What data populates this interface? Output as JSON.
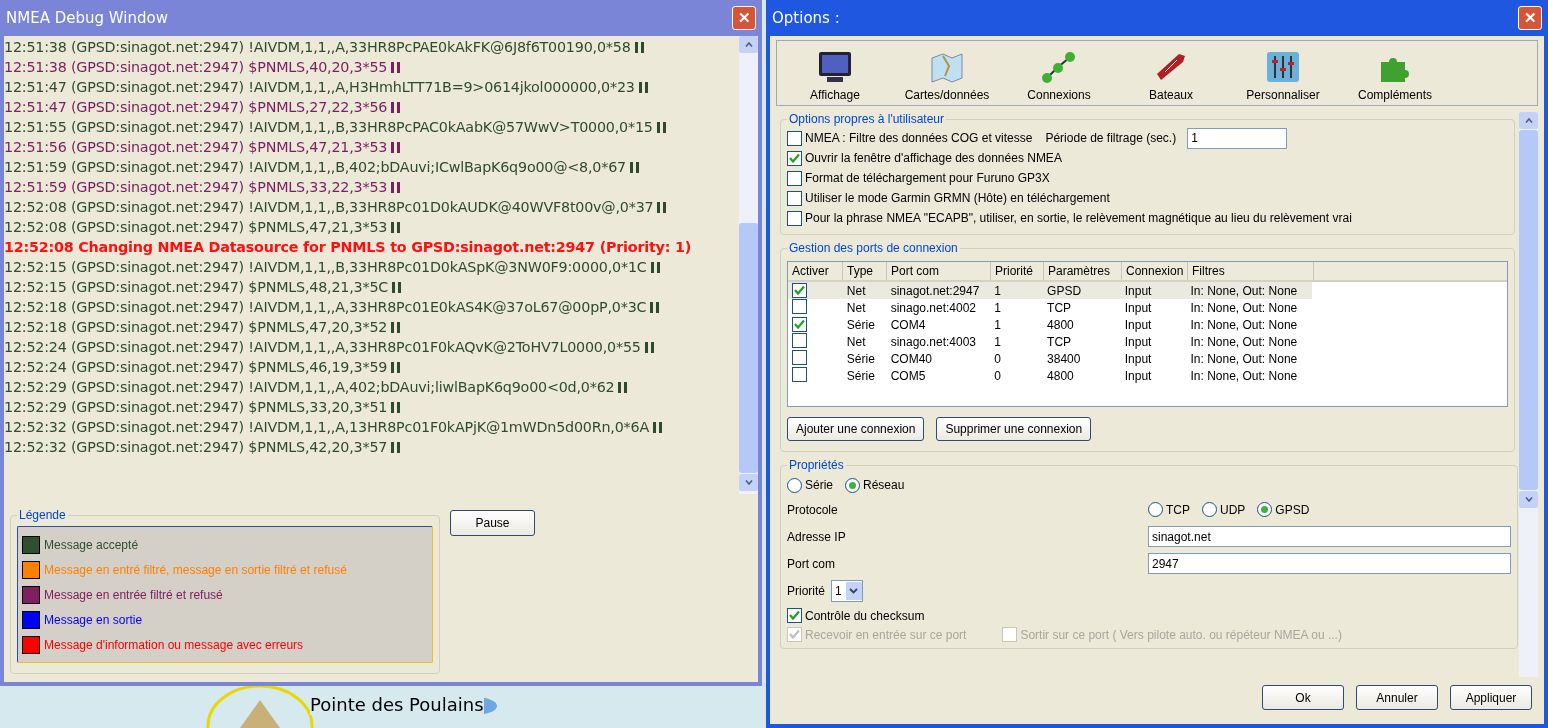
{
  "debug_window": {
    "title": "NMEA Debug Window",
    "close": "✕",
    "lines": [
      {
        "kind": "accepted",
        "text": "12:51:38 (GPSD:sinagot.net:2947) !AIVDM,1,1,,A,33HR8PcPAE0kAkFK@6J8f6T00190,0*58",
        "eol": true
      },
      {
        "kind": "filtered",
        "text": "12:51:38 (GPSD:sinagot.net:2947) $PNMLS,40,20,3*55",
        "eol": true
      },
      {
        "kind": "accepted",
        "text": "12:51:47 (GPSD:sinagot.net:2947) !AIVDM,1,1,,A,H3HmhLTT71B=9>0614jkol000000,0*23",
        "eol": true
      },
      {
        "kind": "filtered",
        "text": "12:51:47 (GPSD:sinagot.net:2947) $PNMLS,27,22,3*56",
        "eol": true
      },
      {
        "kind": "accepted",
        "text": "12:51:55 (GPSD:sinagot.net:2947) !AIVDM,1,1,,B,33HR8PcPAC0kAabK@57WwV>T0000,0*15",
        "eol": true
      },
      {
        "kind": "filtered",
        "text": "12:51:56 (GPSD:sinagot.net:2947) $PNMLS,47,21,3*53",
        "eol": true
      },
      {
        "kind": "accepted",
        "text": "12:51:59 (GPSD:sinagot.net:2947) !AIVDM,1,1,,B,402;bDAuvi;ICwlBapK6q9o00@<8,0*67",
        "eol": true
      },
      {
        "kind": "filtered",
        "text": "12:51:59 (GPSD:sinagot.net:2947) $PNMLS,33,22,3*53",
        "eol": true
      },
      {
        "kind": "accepted",
        "text": "12:52:08 (GPSD:sinagot.net:2947) !AIVDM,1,1,,B,33HR8Pc01D0kAUDK@40WVF8t00v@,0*37",
        "eol": true
      },
      {
        "kind": "accepted",
        "text": "12:52:08 (GPSD:sinagot.net:2947) $PNMLS,47,21,3*53",
        "eol": true
      },
      {
        "kind": "info",
        "text": "12:52:08 Changing NMEA Datasource for PNMLS to GPSD:sinagot.net:2947 (Priority: 1)",
        "eol": false
      },
      {
        "kind": "accepted",
        "text": "12:52:15 (GPSD:sinagot.net:2947) !AIVDM,1,1,,B,33HR8Pc01D0kASpK@3NW0F9:0000,0*1C",
        "eol": true
      },
      {
        "kind": "accepted",
        "text": "12:52:15 (GPSD:sinagot.net:2947) $PNMLS,48,21,3*5C",
        "eol": true
      },
      {
        "kind": "accepted",
        "text": "12:52:18 (GPSD:sinagot.net:2947) !AIVDM,1,1,,A,33HR8Pc01E0kAS4K@37oL67@00pP,0*3C",
        "eol": true
      },
      {
        "kind": "accepted",
        "text": "12:52:18 (GPSD:sinagot.net:2947) $PNMLS,47,20,3*52",
        "eol": true
      },
      {
        "kind": "accepted",
        "text": "12:52:24 (GPSD:sinagot.net:2947) !AIVDM,1,1,,A,33HR8Pc01F0kAQvK@2ToHV7L0000,0*55",
        "eol": true
      },
      {
        "kind": "accepted",
        "text": "12:52:24 (GPSD:sinagot.net:2947) $PNMLS,46,19,3*59",
        "eol": true
      },
      {
        "kind": "accepted",
        "text": "12:52:29 (GPSD:sinagot.net:2947) !AIVDM,1,1,,A,402;bDAuvi;liwlBapK6q9o00<0d,0*62",
        "eol": true
      },
      {
        "kind": "accepted",
        "text": "12:52:29 (GPSD:sinagot.net:2947) $PNMLS,33,20,3*51",
        "eol": true
      },
      {
        "kind": "accepted",
        "text": "12:52:32 (GPSD:sinagot.net:2947) !AIVDM,1,1,,A,13HR8Pc01F0kAPjK@1mWDn5d00Rn,0*6A",
        "eol": true
      },
      {
        "kind": "accepted",
        "text": "12:52:32 (GPSD:sinagot.net:2947) $PNMLS,42,20,3*57",
        "eol": true
      }
    ],
    "legend": {
      "title": "Légende",
      "items": [
        {
          "color": "#2f4f2f",
          "label": "Message accepté"
        },
        {
          "color": "#ff8000",
          "label": "Message en entré filtré, message en sortie filtré et refusé"
        },
        {
          "color": "#802060",
          "label": "Message en entrée filtré et refusé"
        },
        {
          "color": "#0000ff",
          "label": "Message en sortie"
        },
        {
          "color": "#ff0000",
          "label": "Message d'information ou message avec erreurs"
        }
      ]
    },
    "pause_button": "Pause"
  },
  "map": {
    "label": "Pointe des Poulains"
  },
  "options_window": {
    "title": "Options :",
    "close": "✕",
    "toolbar": [
      "Affichage",
      "Cartes/données",
      "Connexions",
      "Bateaux",
      "Personnaliser",
      "Compléments"
    ],
    "user_options": {
      "title": "Options propres à l'utilisateur",
      "items": [
        {
          "label": "NMEA : Filtre des données COG et vitesse",
          "checked": false,
          "period_label": "Période de filtrage (sec.)",
          "period_value": "1"
        },
        {
          "label": "Ouvrir la fenêtre d'affichage des données NMEA",
          "checked": true
        },
        {
          "label": "Format de téléchargement pour Furuno GP3X",
          "checked": false
        },
        {
          "label": "Utiliser le mode Garmin GRMN (Hôte) en téléchargement",
          "checked": false
        },
        {
          "label": "Pour la phrase NMEA \"ECAPB\", utiliser, en sortie, le relèvement magnétique  au lieu du relèvement vrai",
          "checked": false
        }
      ]
    },
    "ports": {
      "title": "Gestion des ports de connexion",
      "columns": [
        "Activer",
        "Type",
        "Port com",
        "Priorité",
        "Paramètres",
        "Connexion",
        "Filtres"
      ],
      "rows": [
        {
          "active": true,
          "selected": true,
          "type": "Net",
          "port_com": "sinagot.net:2947",
          "priority": "1",
          "parameters": "GPSD",
          "connection": "Input",
          "filters": "In: None, Out: None"
        },
        {
          "active": false,
          "selected": false,
          "type": "Net",
          "port_com": "sinago.net:4002",
          "priority": "1",
          "parameters": "TCP",
          "connection": "Input",
          "filters": "In: None, Out: None"
        },
        {
          "active": true,
          "selected": false,
          "type": "Série",
          "port_com": "COM4",
          "priority": "1",
          "parameters": "4800",
          "connection": "Input",
          "filters": "In: None, Out: None"
        },
        {
          "active": false,
          "selected": false,
          "type": "Net",
          "port_com": "sinago.net:4003",
          "priority": "1",
          "parameters": "TCP",
          "connection": "Input",
          "filters": "In: None, Out: None"
        },
        {
          "active": false,
          "selected": false,
          "type": "Série",
          "port_com": "COM40",
          "priority": "0",
          "parameters": "38400",
          "connection": "Input",
          "filters": "In: None, Out: None"
        },
        {
          "active": false,
          "selected": false,
          "type": "Série",
          "port_com": "COM5",
          "priority": "0",
          "parameters": "4800",
          "connection": "Input",
          "filters": "In: None, Out: None"
        }
      ],
      "buttons": [
        "Ajouter une connexion",
        "Supprimer une connexion"
      ]
    },
    "properties": {
      "title": "Propriétés",
      "source": [
        {
          "label": "Série",
          "selected": false
        },
        {
          "label": "Réseau",
          "selected": true
        }
      ],
      "protocol_label": "Protocole",
      "protocol": [
        {
          "label": "TCP",
          "selected": false
        },
        {
          "label": "UDP",
          "selected": false
        },
        {
          "label": "GPSD",
          "selected": true
        }
      ],
      "fields": [
        {
          "label": "Adresse IP",
          "value": "sinagot.net"
        },
        {
          "label": "Port com",
          "value": "2947"
        }
      ],
      "priority_label": "Priorité",
      "priority_value": "1",
      "checks": [
        {
          "label": "Contrôle du checksum",
          "checked": true,
          "disabled": false
        },
        {
          "label": "Recevoir en entrée sur ce port",
          "checked": true,
          "disabled": true
        },
        {
          "label": "Sortir sur ce port ( Vers pilote auto. ou répéteur NMEA ou ...)",
          "checked": false,
          "disabled": true
        }
      ]
    },
    "buttons": [
      "Ok",
      "Annuler",
      "Appliquer"
    ]
  }
}
